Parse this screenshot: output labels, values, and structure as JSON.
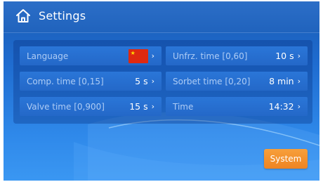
{
  "header": {
    "title": "Settings"
  },
  "settings": {
    "language": {
      "label": "Language",
      "flag": "china-flag"
    },
    "comp_time": {
      "label": "Comp. time  [0,15]",
      "value": "5 s"
    },
    "valve_time": {
      "label": "Valve time  [0,900]",
      "value": "15 s"
    },
    "unfrz_time": {
      "label": "Unfrz. time  [0,60]",
      "value": "10 s"
    },
    "sorbet_time": {
      "label": "Sorbet time  [0,20]",
      "value": "8 min"
    },
    "time": {
      "label": "Time",
      "value": "14:32"
    },
    "chevron": "›"
  },
  "footer": {
    "system_label": "System"
  },
  "colors": {
    "accent": "#f29030",
    "background": "#1f6cd0"
  }
}
